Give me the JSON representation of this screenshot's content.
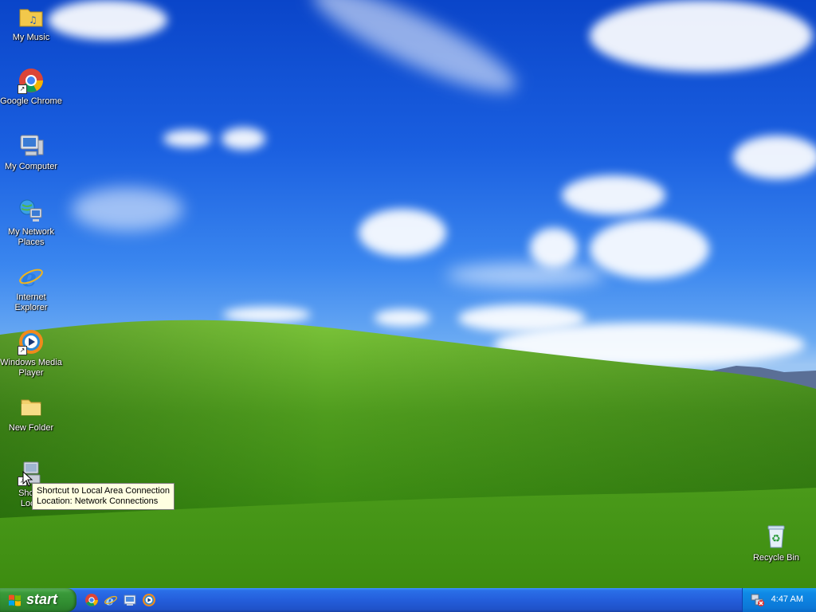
{
  "desktop": {
    "icons": [
      {
        "label": "My Music"
      },
      {
        "label": "Google Chrome"
      },
      {
        "label": "My Computer"
      },
      {
        "label": "My Network Places"
      },
      {
        "label": "Internet Explorer"
      },
      {
        "label": "Windows Media Player"
      },
      {
        "label": "New Folder"
      },
      {
        "label": "Shortcut to Local Area Connection"
      },
      {
        "label": "Recycle Bin"
      }
    ],
    "shortcut_label_visible_top": "Shortc",
    "shortcut_label_visible_bottom": "Local",
    "tooltip": {
      "line1": "Shortcut to Local Area Connection",
      "line2": "Location: Network Connections"
    }
  },
  "taskbar": {
    "start_label": "start",
    "quick_launch": [
      "chrome-icon",
      "internet-explorer-icon",
      "show-desktop-icon",
      "windows-media-player-icon"
    ],
    "clock": "4:47 AM"
  }
}
